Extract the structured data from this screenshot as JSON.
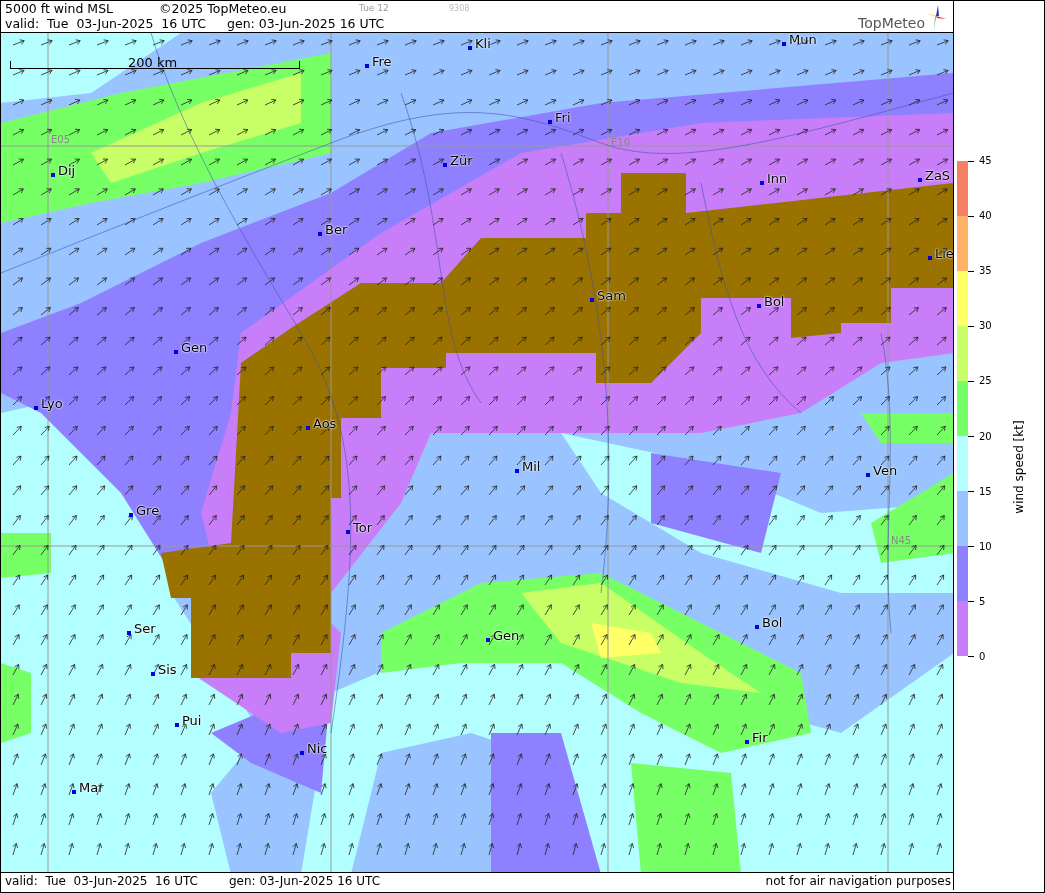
{
  "header": {
    "title": "5000 ft wind MSL",
    "copyright": "©2025 TopMeteo.eu",
    "run_label": "Tue 12",
    "code": "9308",
    "valid": "valid:  Tue  03-Jun-2025  16 UTC",
    "generated": "gen: 03-Jun-2025 16 UTC",
    "logo_text": "TopMeteo"
  },
  "map": {
    "scale_label": "200 km",
    "grid_labels": [
      "E05",
      "E10",
      "N45"
    ],
    "cities": [
      "Kli",
      "Mun",
      "Fre",
      "Fri",
      "Zür",
      "Dij",
      "Inn",
      "ZaS",
      "Ber",
      "Lie",
      "Sam",
      "Bol",
      "Gen",
      "Lyo",
      "Aos",
      "Mil",
      "Ven",
      "Gre",
      "Tor",
      "Ser",
      "Bol",
      "Gen",
      "Sis",
      "Pui",
      "Fir",
      "Nic",
      "Mar"
    ]
  },
  "legend": {
    "title": "wind speed [kt]",
    "ticks": [
      "45",
      "40",
      "35",
      "30",
      "25",
      "20",
      "15",
      "10",
      "5",
      "0"
    ],
    "bands": [
      {
        "color": "#f58066"
      },
      {
        "color": "#ffb366"
      },
      {
        "color": "#ffff66"
      },
      {
        "color": "#c8ff66"
      },
      {
        "color": "#77ff66"
      },
      {
        "color": "#b3ffff"
      },
      {
        "color": "#99c4ff"
      },
      {
        "color": "#8f80ff"
      },
      {
        "color": "#c87ef8"
      }
    ]
  },
  "footer": {
    "valid": "valid:  Tue  03-Jun-2025  16 UTC",
    "generated": "gen: 03-Jun-2025 16 UTC",
    "disclaimer": "not for air navigation purposes"
  }
}
